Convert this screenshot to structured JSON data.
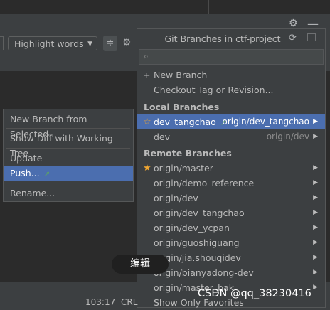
{
  "toolbar": {
    "highlight_label": "Highlight words",
    "highlight_arrow": "▼",
    "filter_icon": "≑",
    "gear_icon": "⚙",
    "minus_icon": "—"
  },
  "popup": {
    "title": "Git Branches in ctf-project",
    "search_placeholder": "",
    "actions": [
      {
        "prefix": "+",
        "label": "New Branch"
      },
      {
        "prefix": "",
        "label": "Checkout Tag or Revision..."
      }
    ],
    "local_header": "Local Branches",
    "local_branches": [
      {
        "name": "dev_tangchao",
        "tracking": "origin/dev_tangchao",
        "starred": true,
        "current": true,
        "selected": true
      },
      {
        "name": "dev",
        "tracking": "origin/dev",
        "starred": false,
        "current": false,
        "selected": false
      }
    ],
    "remote_header": "Remote Branches",
    "remote_branches": [
      {
        "name": "origin/master",
        "starred": true
      },
      {
        "name": "origin/demo_reference",
        "starred": false
      },
      {
        "name": "origin/dev",
        "starred": false
      },
      {
        "name": "origin/dev_tangchao",
        "starred": false
      },
      {
        "name": "origin/dev_ycpan",
        "starred": false
      },
      {
        "name": "origin/guoshiguang",
        "starred": false
      },
      {
        "name": "origin/jia.shouqidev",
        "starred": false
      },
      {
        "name": "origin/bianyadong-dev",
        "starred": false
      },
      {
        "name": "origin/master_bak",
        "starred": false
      }
    ],
    "footer": "Show Only Favorites"
  },
  "context_menu": {
    "items": [
      {
        "label": "New Branch from Selected...",
        "selected": false
      },
      {
        "label": "Show Diff with Working Tree",
        "selected": false
      },
      {
        "label": "Update",
        "selected": false
      },
      {
        "label": "Push...",
        "selected": true
      },
      {
        "label": "Rename...",
        "selected": false
      }
    ]
  },
  "tooltip": "编辑",
  "status": {
    "position": "103:17",
    "line_sep": "CRL"
  },
  "watermark": "CSDN @qq_38230416",
  "colors": {
    "selection": "#4b6eaf",
    "star": "#f0a732",
    "push_arrow": "#5a9e6b"
  }
}
